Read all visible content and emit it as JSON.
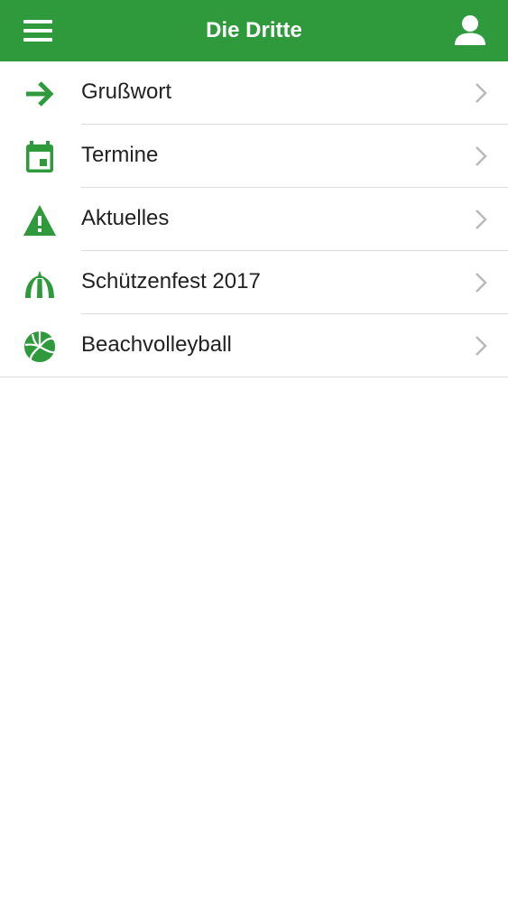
{
  "header": {
    "title": "Die Dritte",
    "menu_icon": "hamburger-menu-icon",
    "user_icon": "user-icon",
    "background_color": "#2f9a3b",
    "text_color": "#ffffff"
  },
  "menu": {
    "accent_color": "#2f9a3b",
    "items": [
      {
        "label": "Grußwort",
        "icon": "arrow-right-icon"
      },
      {
        "label": "Termine",
        "icon": "calendar-icon"
      },
      {
        "label": "Aktuelles",
        "icon": "warning-icon"
      },
      {
        "label": "Schützenfest 2017",
        "icon": "tent-icon"
      },
      {
        "label": "Beachvolleyball",
        "icon": "volleyball-icon"
      }
    ],
    "chevron_icon": "chevron-right-icon"
  }
}
